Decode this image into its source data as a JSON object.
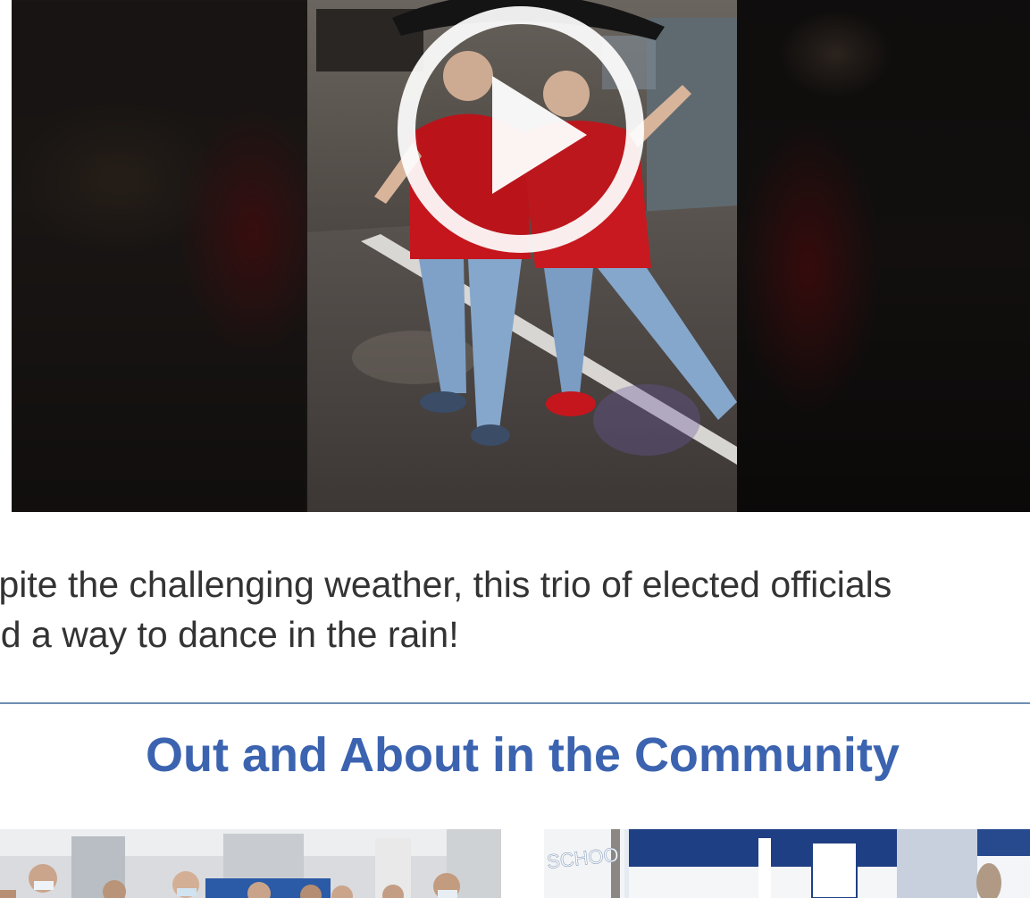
{
  "video": {
    "play_label": "Play video",
    "colors": {
      "shirt": "#c4161c",
      "jeans": "#7fa1c8",
      "pavement": "#4a4644",
      "umbrella": "#141414"
    }
  },
  "caption": {
    "line1": "spite the challenging weather, this trio of elected officials",
    "line2": "nd a way to dance in the rain!"
  },
  "section": {
    "title": "Out and About in the Community",
    "title_color": "#3b63b0"
  },
  "photos": {
    "right_sign_text": "SCHOO"
  }
}
